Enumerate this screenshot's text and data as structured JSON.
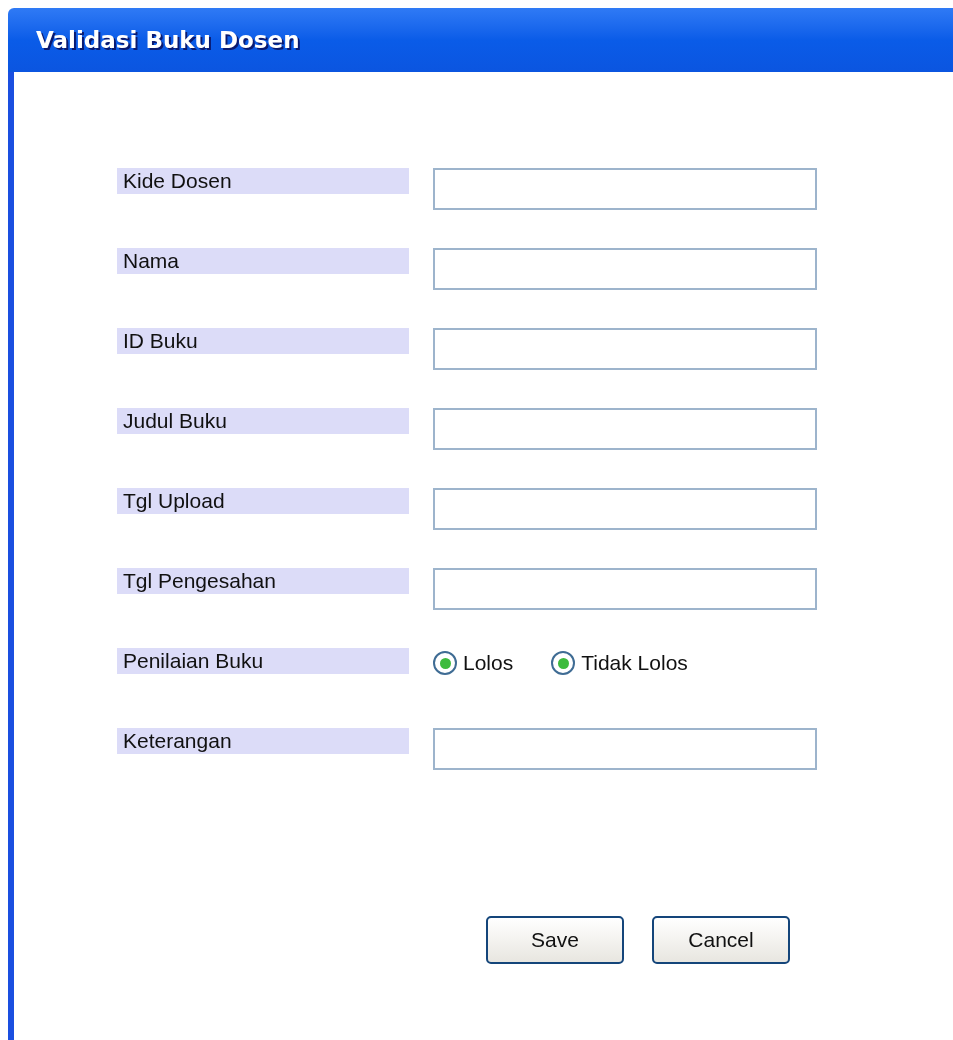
{
  "window": {
    "title": "Validasi Buku Dosen"
  },
  "fields": [
    {
      "kind": "text",
      "label": "Kide Dosen"
    },
    {
      "kind": "text",
      "label": "Nama"
    },
    {
      "kind": "text",
      "label": "ID Buku"
    },
    {
      "kind": "text",
      "label": "Judul Buku"
    },
    {
      "kind": "text",
      "label": "Tgl Upload"
    },
    {
      "kind": "text",
      "label": "Tgl Pengesahan"
    },
    {
      "kind": "radio",
      "label": "Penilaian Buku",
      "options": [
        {
          "label": "Lolos",
          "selected": true
        },
        {
          "label": "Tidak Lolos",
          "selected": true
        }
      ]
    },
    {
      "kind": "text",
      "label": "Keterangan"
    }
  ],
  "buttons": [
    "Save",
    "Cancel"
  ]
}
